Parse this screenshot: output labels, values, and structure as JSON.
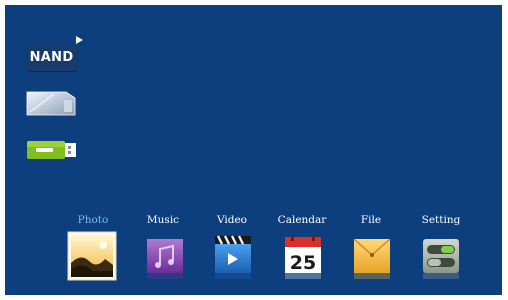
{
  "sources": {
    "nand_label": "NAND",
    "sd_icon": "sd-card-icon",
    "usb_icon": "usb-drive-icon"
  },
  "menu": {
    "items": [
      {
        "label": "Photo",
        "icon": "photo-icon",
        "active": true
      },
      {
        "label": "Music",
        "icon": "music-icon"
      },
      {
        "label": "Video",
        "icon": "video-icon"
      },
      {
        "label": "Calendar",
        "icon": "calendar-icon",
        "day": "25"
      },
      {
        "label": "File",
        "icon": "file-folder-icon"
      },
      {
        "label": "Setting",
        "icon": "setting-icon"
      }
    ]
  },
  "colors": {
    "background": "#0d3f7e",
    "active_label": "#7cb7f5",
    "label": "#ffffff"
  }
}
